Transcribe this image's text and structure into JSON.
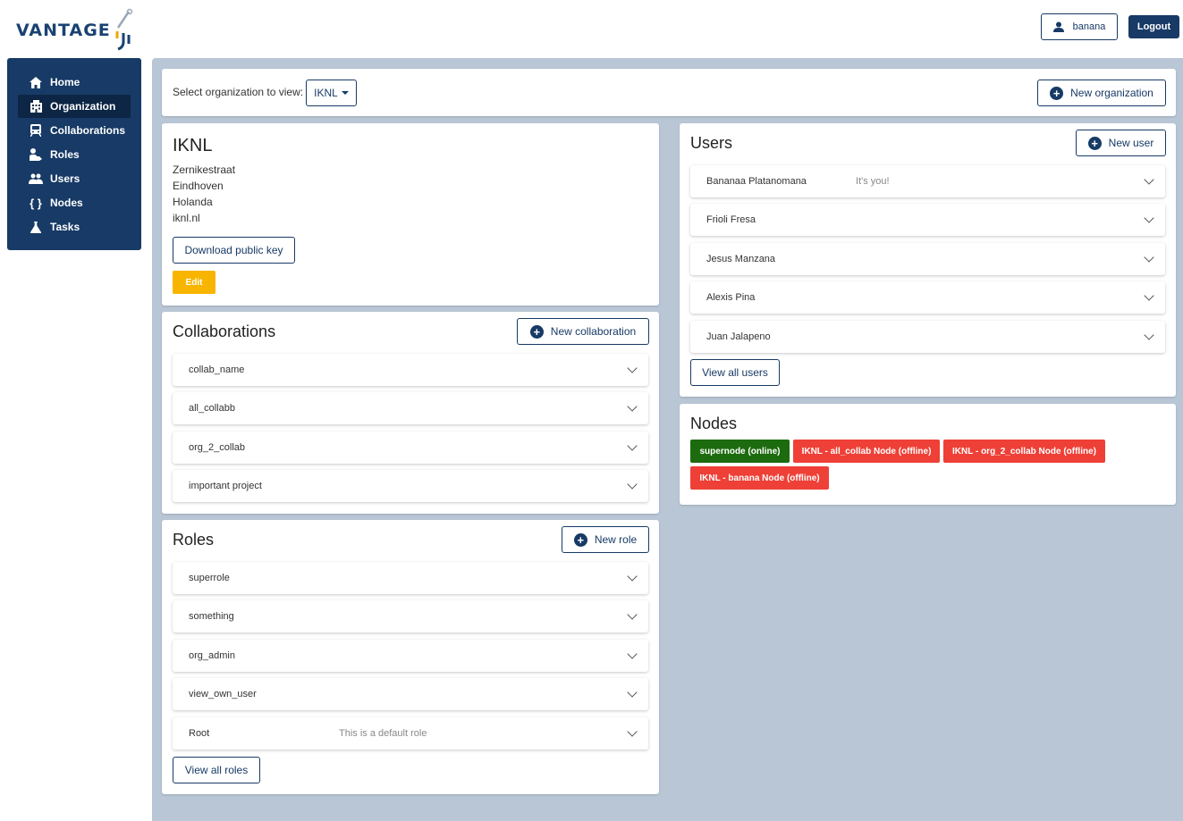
{
  "app": {
    "logo_text": "VANTAGE",
    "user_name": "banana",
    "logout_label": "Logout"
  },
  "sidebar": {
    "items": [
      {
        "label": "Home",
        "icon": "home-icon",
        "active": false
      },
      {
        "label": "Organization",
        "icon": "building-icon",
        "active": true
      },
      {
        "label": "Collaborations",
        "icon": "train-icon",
        "active": false
      },
      {
        "label": "Roles",
        "icon": "user-tag-icon",
        "active": false
      },
      {
        "label": "Users",
        "icon": "users-icon",
        "active": false
      },
      {
        "label": "Nodes",
        "icon": "braces-icon",
        "active": false
      },
      {
        "label": "Tasks",
        "icon": "flask-icon",
        "active": false
      }
    ]
  },
  "org_select": {
    "label": "Select organization to view:",
    "selected": "IKNL",
    "new_org_label": "New organization"
  },
  "organization": {
    "name": "IKNL",
    "address_lines": [
      "Zernikestraat",
      "Eindhoven",
      "Holanda",
      "iknl.nl"
    ],
    "download_key_label": "Download public key",
    "edit_label": "Edit"
  },
  "collaborations": {
    "title": "Collaborations",
    "new_label": "New collaboration",
    "items": [
      "collab_name",
      "all_collabb",
      "org_2_collab",
      "important project"
    ]
  },
  "roles": {
    "title": "Roles",
    "new_label": "New role",
    "items": [
      {
        "name": "superrole",
        "desc": ""
      },
      {
        "name": "something",
        "desc": ""
      },
      {
        "name": "org_admin",
        "desc": ""
      },
      {
        "name": "view_own_user",
        "desc": ""
      },
      {
        "name": "Root",
        "desc": "This is a default role"
      }
    ],
    "view_all_label": "View all roles"
  },
  "users": {
    "title": "Users",
    "new_label": "New user",
    "items": [
      {
        "name": "Bananaa Platanomana",
        "desc": "It's you!"
      },
      {
        "name": "Frioli Fresa",
        "desc": ""
      },
      {
        "name": "Jesus Manzana",
        "desc": ""
      },
      {
        "name": "Alexis Pina",
        "desc": ""
      },
      {
        "name": "Juan Jalapeno",
        "desc": ""
      }
    ],
    "view_all_label": "View all users"
  },
  "nodes": {
    "title": "Nodes",
    "items": [
      {
        "label": "supernode (online)",
        "status": "online"
      },
      {
        "label": "IKNL - all_collab Node (offline)",
        "status": "offline"
      },
      {
        "label": "IKNL - org_2_collab Node (offline)",
        "status": "offline"
      },
      {
        "label": "IKNL - banana Node (offline)",
        "status": "offline"
      }
    ]
  },
  "colors": {
    "primary": "#173a66",
    "background": "#b8c6d5",
    "edit": "#f7b500",
    "online": "#1d6b0f",
    "offline": "#ee4037"
  }
}
